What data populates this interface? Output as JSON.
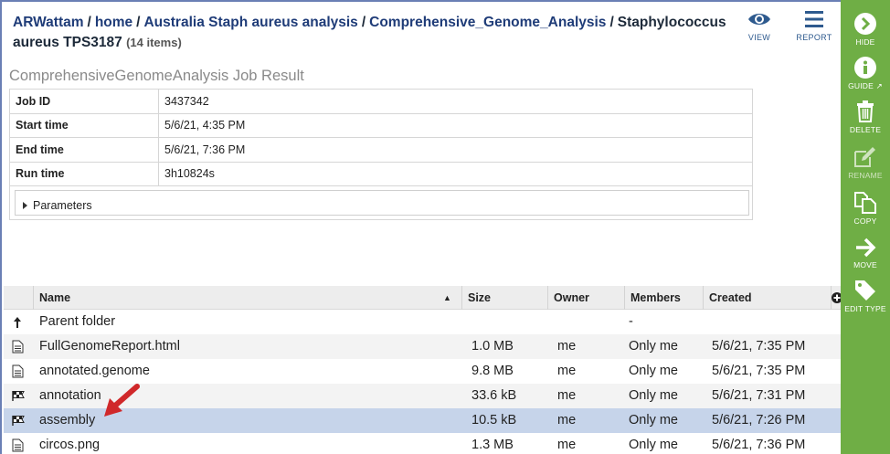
{
  "breadcrumb": {
    "items": [
      "ARWattam",
      "home",
      "Australia Staph aureus analysis",
      "Comprehensive_Genome_Analysis"
    ],
    "current": "Staphylococcus aureus TPS3187",
    "separator": "/",
    "count": "(14 items)"
  },
  "toolbar": {
    "view_label": "VIEW",
    "report_label": "REPORT"
  },
  "job": {
    "title": "ComprehensiveGenomeAnalysis Job Result",
    "rows": [
      {
        "key": "Job ID",
        "value": "3437342"
      },
      {
        "key": "Start time",
        "value": "5/6/21, 4:35 PM"
      },
      {
        "key": "End time",
        "value": "5/6/21, 7:36 PM"
      },
      {
        "key": "Run time",
        "value": "3h10824s"
      }
    ],
    "parameters_label": "Parameters"
  },
  "grid": {
    "columns": {
      "name": "Name",
      "size": "Size",
      "owner": "Owner",
      "members": "Members",
      "created": "Created"
    },
    "rows": [
      {
        "icon": "up-arrow-icon",
        "name": "Parent folder",
        "size": "",
        "owner": "",
        "members": "-",
        "created": ""
      },
      {
        "icon": "document-icon",
        "name": "FullGenomeReport.html",
        "size": "1.0 MB",
        "owner": "me",
        "members": "Only me",
        "created": "5/6/21, 7:35 PM"
      },
      {
        "icon": "document-icon",
        "name": "annotated.genome",
        "size": "9.8 MB",
        "owner": "me",
        "members": "Only me",
        "created": "5/6/21, 7:35 PM"
      },
      {
        "icon": "flag-icon",
        "name": "annotation",
        "size": "33.6 kB",
        "owner": "me",
        "members": "Only me",
        "created": "5/6/21, 7:31 PM"
      },
      {
        "icon": "flag-icon",
        "name": "assembly",
        "size": "10.5 kB",
        "owner": "me",
        "members": "Only me",
        "created": "5/6/21, 7:26 PM"
      },
      {
        "icon": "document-icon",
        "name": "circos.png",
        "size": "1.3 MB",
        "owner": "me",
        "members": "Only me",
        "created": "5/6/21, 7:36 PM"
      }
    ]
  },
  "sidebar": {
    "hide": "HIDE",
    "guide": "GUIDE",
    "delete": "DELETE",
    "rename": "RENAME",
    "copy": "COPY",
    "move": "MOVE",
    "edit_type": "EDIT TYPE"
  },
  "colors": {
    "sidebar": "#6fae45",
    "selected_row": "#c6d4ea",
    "link": "#1f3c78",
    "arrow": "#d0282a"
  }
}
